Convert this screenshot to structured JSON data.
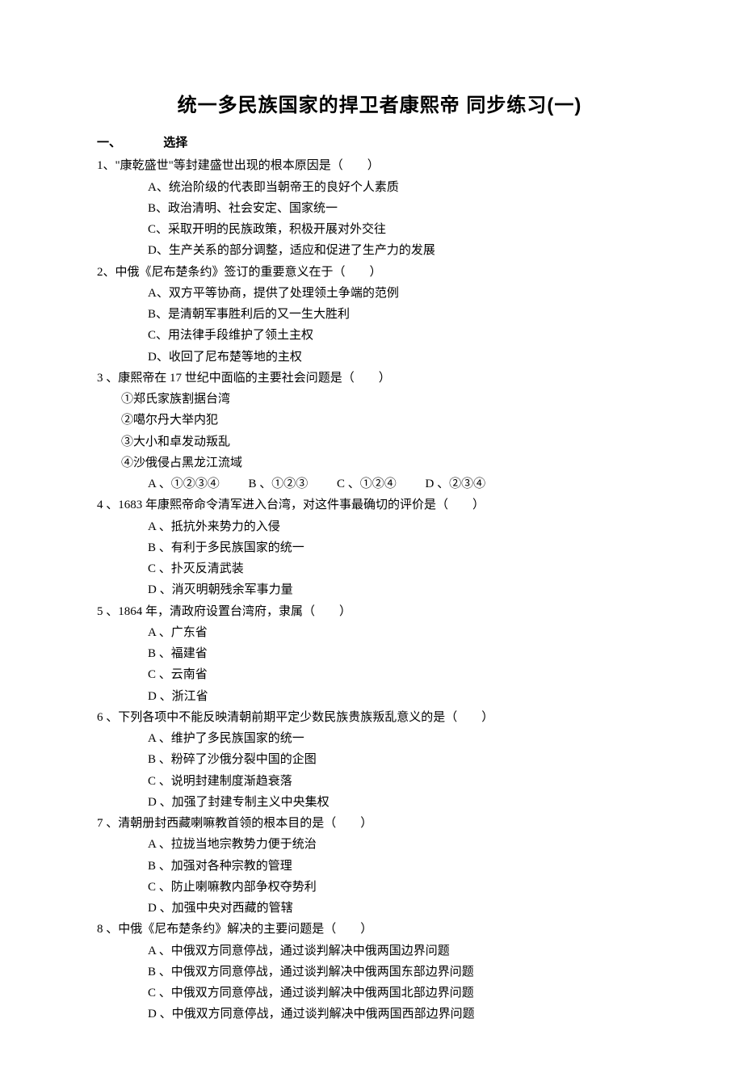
{
  "title": "统一多民族国家的捍卫者康熙帝  同步练习(一)",
  "section": {
    "num": "一、",
    "label": "选择"
  },
  "questions": [
    {
      "num": "1、",
      "stem": "\"康乾盛世\"等封建盛世出现的根本原因是（　　）",
      "options": [
        "A、统治阶级的代表即当朝帝王的良好个人素质",
        "B、政治清明、社会安定、国家统一",
        "C、采取开明的民族政策，积极开展对外交往",
        "D、生产关系的部分调整，适应和促进了生产力的发展"
      ]
    },
    {
      "num": "2、",
      "stem": "中俄《尼布楚条约》签订的重要意义在于（　　）",
      "options": [
        "A、双方平等协商，提供了处理领土争端的范例",
        "B、是清朝军事胜利后的又一生大胜利",
        "C、用法律手段维护了领土主权",
        "D、收回了尼布楚等地的主权"
      ]
    },
    {
      "num": "3 、",
      "stem": "康熙帝在 17 世纪中面临的主要社会问题是（　　）",
      "sublines": [
        "①郑氏家族割据台湾",
        "②噶尔丹大举内犯",
        "③大小和卓发动叛乱",
        "④沙俄侵占黑龙江流域"
      ],
      "inline_options": [
        "A 、①②③④",
        "B 、①②③",
        "C 、①②④",
        "D 、②③④"
      ]
    },
    {
      "num": "4 、",
      "stem": "1683 年康熙帝命令清军进入台湾，对这件事最确切的评价是（　　）",
      "options": [
        "A 、抵抗外来势力的入侵",
        "B 、有利于多民族国家的统一",
        "C 、扑灭反清武装",
        "D 、消灭明朝残余军事力量"
      ]
    },
    {
      "num": "5 、",
      "stem": "1864 年，清政府设置台湾府，隶属（　　）",
      "options": [
        "A 、广东省",
        "B 、福建省",
        "C 、云南省",
        "D 、浙江省"
      ]
    },
    {
      "num": "6 、",
      "stem": "下列各项中不能反映清朝前期平定少数民族贵族叛乱意义的是（　　）",
      "options": [
        "A 、维护了多民族国家的统一",
        "B 、粉碎了沙俄分裂中国的企图",
        "C 、说明封建制度渐趋衰落",
        "D 、加强了封建专制主义中央集权"
      ]
    },
    {
      "num": "7 、",
      "stem": "清朝册封西藏喇嘛教首领的根本目的是（　　）",
      "options": [
        "A 、拉拢当地宗教势力便于统治",
        "B 、加强对各种宗教的管理",
        "C 、防止喇嘛教内部争权夺势利",
        "D 、加强中央对西藏的管辖"
      ]
    },
    {
      "num": "8 、",
      "stem": "中俄《尼布楚条约》解决的主要问题是（　　）",
      "options": [
        "A 、中俄双方同意停战，通过谈判解决中俄两国边界问题",
        "B 、中俄双方同意停战，通过谈判解决中俄两国东部边界问题",
        "C 、中俄双方同意停战，通过谈判解决中俄两国北部边界问题",
        "D 、中俄双方同意停战，通过谈判解决中俄两国西部边界问题"
      ]
    }
  ]
}
